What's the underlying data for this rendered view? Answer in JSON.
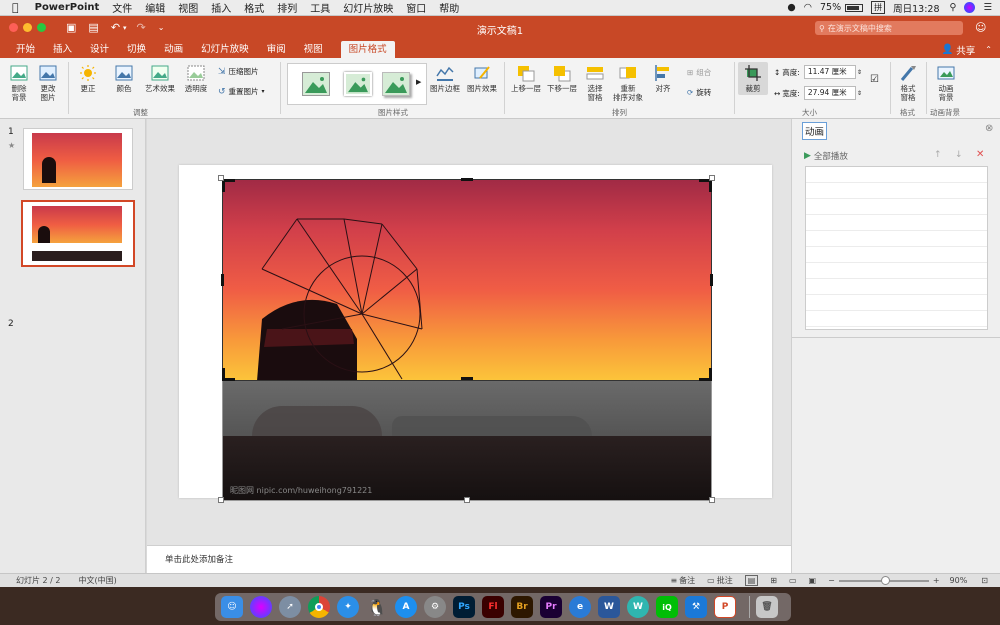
{
  "menubar": {
    "app": "PowerPoint",
    "items": [
      "文件",
      "编辑",
      "视图",
      "插入",
      "格式",
      "排列",
      "工具",
      "幻灯片放映",
      "窗口",
      "帮助"
    ],
    "battery": "75%",
    "input_method": "拼",
    "clock": "周日13:28"
  },
  "window": {
    "title": "演示文稿1",
    "search_placeholder": "在演示文稿中搜索",
    "share": "共享"
  },
  "tabs": [
    "开始",
    "插入",
    "设计",
    "切换",
    "动画",
    "幻灯片放映",
    "审阅",
    "视图",
    "图片格式"
  ],
  "active_tab": "图片格式",
  "ribbon": {
    "remove_bg": [
      "删除",
      "背景"
    ],
    "change_pic": [
      "更改",
      "图片"
    ],
    "corrections": "更正",
    "color": "颜色",
    "artistic": "艺术效果",
    "transparency": "透明度",
    "compress": "压缩图片",
    "reset": "重置图片",
    "group_adjust": "调整",
    "picture_border": "图片边框",
    "picture_effects": "图片效果",
    "group_styles": "图片样式",
    "bring_forward": "上移一层",
    "send_backward": "下移一层",
    "selection_pane": [
      "选择",
      "窗格"
    ],
    "reorder": [
      "重新",
      "排序对象"
    ],
    "align": "对齐",
    "group": "组合",
    "rotate": "旋转",
    "group_arrange": "排列",
    "crop": "裁剪",
    "height_label": "高度:",
    "height_value": "11.47 厘米",
    "width_label": "宽度:",
    "width_value": "27.94 厘米",
    "group_size": "大小",
    "format_pane": [
      "格式",
      "窗格"
    ],
    "group_format": "格式",
    "anim_bg": [
      "动画",
      "背景"
    ],
    "group_anim_bg": "动画背景"
  },
  "slides_panel": [
    {
      "number": "1",
      "star": "★"
    },
    {
      "number": "2",
      "star": ""
    }
  ],
  "slide": {
    "watermark": "昵图网 nipic.com/huweihong791221"
  },
  "notes_placeholder": "单击此处添加备注",
  "animation_pane": {
    "title": "动画",
    "play_all": "全部播放"
  },
  "status": {
    "slide_info": "幻灯片 2 / 2",
    "language": "中文(中国)",
    "notes": "备注",
    "comments": "批注",
    "zoom": "90%"
  },
  "dock_apps": [
    "Finder",
    "Siri",
    "Launchpad",
    "Chrome",
    "Safari",
    "QQ",
    "App Store",
    "System Preferences",
    "Ps",
    "Fl",
    "Br",
    "Pr",
    "Edge",
    "W",
    "Wunderlist",
    "iQIYI",
    "Xcode",
    "P",
    "Trash"
  ],
  "colors": {
    "accent": "#c84826"
  }
}
